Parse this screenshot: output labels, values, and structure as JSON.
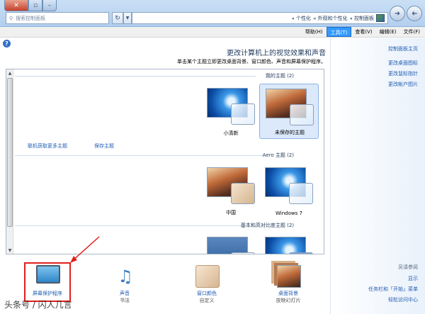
{
  "window": {
    "search_placeholder": "搜索控制面板",
    "address": [
      "控制面板",
      "外观和个性化",
      "个性化"
    ],
    "close_glyph": "✕",
    "max_glyph": "▫",
    "min_glyph": "–"
  },
  "menu": [
    "文件(F)",
    "编辑(E)",
    "查看(V)",
    "工具(T)",
    "帮助(H)"
  ],
  "sidebar": {
    "links": [
      "控制面板主页",
      "更改桌面图标",
      "更改鼠标指针",
      "更改帐户图片"
    ],
    "see_also_label": "另请参阅",
    "see_also": [
      "显示",
      "任务栏和「开始」菜单",
      "轻松访问中心"
    ]
  },
  "main": {
    "heading": "更改计算机上的视觉效果和声音",
    "subheading": "单击某个主题立即更改桌面背景、窗口颜色、声音和屏幕保护程序。",
    "sections": {
      "my_themes": "我的主题 (2)",
      "aero_themes": "Aero 主题 (2)",
      "basic_themes": "基本和高对比度主题 (2)"
    },
    "my_theme_items": [
      "未保存的主题",
      "小清新"
    ],
    "aero_theme_items": [
      "Windows 7",
      "中国"
    ],
    "save_theme_link": "保存主题",
    "online_themes_link": "联机获取更多主题"
  },
  "bottom": [
    {
      "label": "桌面背景",
      "sub": "放映幻灯片"
    },
    {
      "label": "窗口颜色",
      "sub": "自定义"
    },
    {
      "label": "声音",
      "sub": "书法"
    },
    {
      "label": "屏幕保护程序",
      "sub": ""
    }
  ],
  "watermark": "头条号 / 闪人几言",
  "colors": {
    "accent": "#3399ff",
    "link": "#1e5bb0",
    "highlight": "#e0201c"
  }
}
